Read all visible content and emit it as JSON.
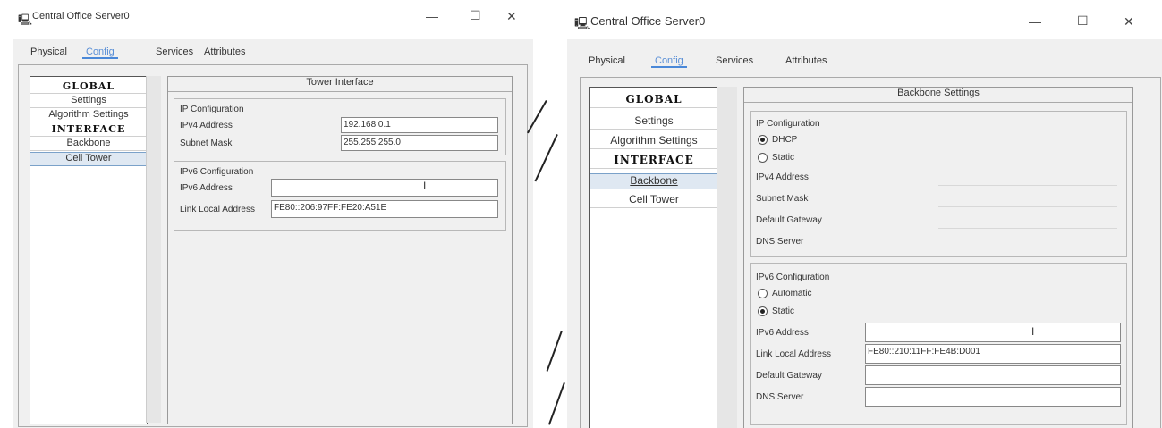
{
  "left_window": {
    "title": "Central Office Server0",
    "title_icon": "server-icon",
    "controls": {
      "minimize": "—",
      "maximize": "☐",
      "close": "✕"
    },
    "tabs": [
      "Physical",
      "Config",
      "Services",
      "Attributes"
    ],
    "active_tab": "Config",
    "sidebar": [
      "GLOBAL",
      "Settings",
      "Algorithm Settings",
      "INTERFACE",
      "Backbone",
      "Cell Tower"
    ],
    "selected_item": "Cell Tower",
    "panel_title": "Tower Interface",
    "ip": {
      "section": "IP Configuration",
      "ipv4_label": "IPv4 Address",
      "ipv4_value": "192.168.0.1",
      "mask_label": "Subnet Mask",
      "mask_value": "255.255.255.0"
    },
    "ipv6": {
      "section": "IPv6 Configuration",
      "addr_label": "IPv6 Address",
      "addr_value": "",
      "link_label": "Link Local Address",
      "link_value": "FE80::206:97FF:FE20:A51E"
    }
  },
  "right_window": {
    "title": "Central Office Server0",
    "title_icon": "server-icon",
    "controls": {
      "minimize": "—",
      "maximize": "☐",
      "close": "✕"
    },
    "tabs": [
      "Physical",
      "Config",
      "Services",
      "Attributes"
    ],
    "active_tab": "Config",
    "sidebar": [
      "GLOBAL",
      "Settings",
      "Algorithm Settings",
      "INTERFACE",
      "Backbone",
      "Cell Tower"
    ],
    "selected_item": "Backbone",
    "panel_title": "Backbone Settings",
    "ip": {
      "section": "IP Configuration",
      "dhcp_label": "DHCP",
      "static_label": "Static",
      "selected_mode": "DHCP",
      "ipv4_label": "IPv4 Address",
      "mask_label": "Subnet Mask",
      "gateway_label": "Default Gateway",
      "dns_label": "DNS Server"
    },
    "ipv6": {
      "section": "IPv6 Configuration",
      "auto_label": "Automatic",
      "static_label": "Static",
      "selected_mode": "Static",
      "addr_label": "IPv6 Address",
      "addr_value": "",
      "link_label": "Link Local Address",
      "link_value": "FE80::210:11FF:FE4B:D001",
      "gateway_label": "Default Gateway",
      "gateway_value": "",
      "dns_label": "DNS Server",
      "dns_value": ""
    }
  }
}
